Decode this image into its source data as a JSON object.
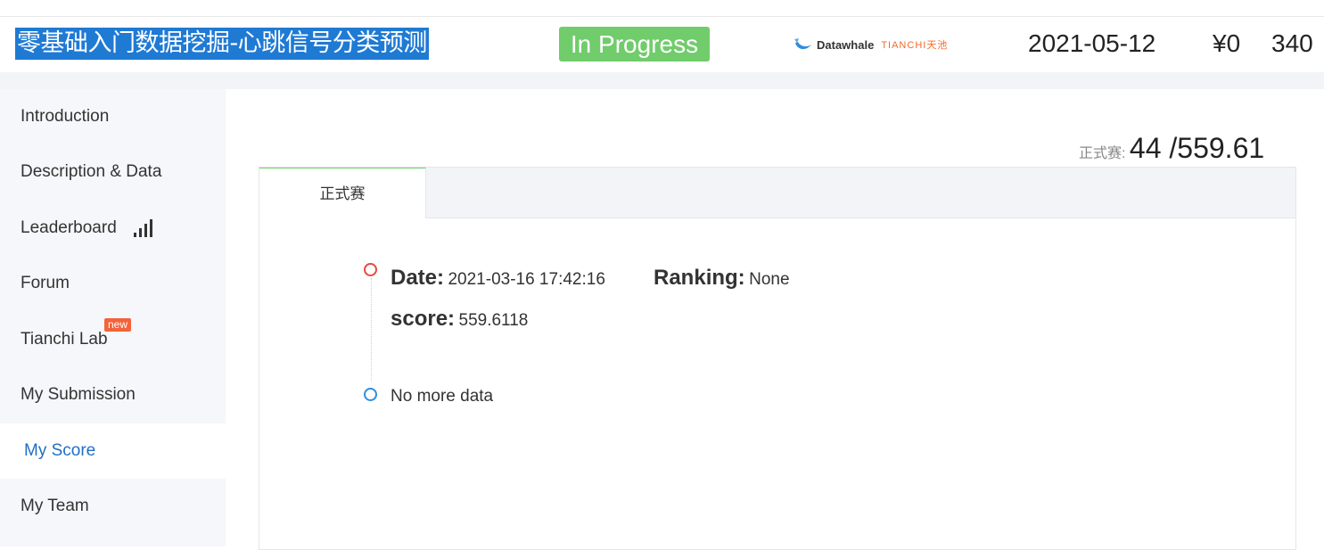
{
  "header": {
    "title": "零基础入门数据挖掘-心跳信号分类预测",
    "status": "In Progress",
    "logo_text_left": "Datawhale",
    "logo_text_right": "TIANCHI天池",
    "date": "2021-05-12",
    "prize": "¥0",
    "count": "340"
  },
  "sidebar": {
    "items": [
      {
        "label": "Introduction"
      },
      {
        "label": "Description & Data"
      },
      {
        "label": "Leaderboard"
      },
      {
        "label": "Forum"
      },
      {
        "label": "Tianchi Lab",
        "badge": "new"
      },
      {
        "label": "My Submission"
      },
      {
        "label": "My Score",
        "active": true
      },
      {
        "label": "My Team"
      }
    ]
  },
  "summary": {
    "label": "正式赛:",
    "value": "44 /559.61"
  },
  "tabs": [
    {
      "label": "正式赛",
      "active": true
    }
  ],
  "timeline": {
    "date_label": "Date:",
    "date_value": "2021-03-16 17:42:16",
    "ranking_label": "Ranking:",
    "ranking_value": "None",
    "score_label": "score:",
    "score_value": "559.6118",
    "end_text": "No more data"
  },
  "colors": {
    "title_highlight": "#1f7ad4",
    "status_green": "#71cc6c",
    "active_link": "#1f6fc5",
    "badge_red": "#f4623a",
    "dot_red": "#e64a3b",
    "dot_blue": "#2d8fe0"
  }
}
